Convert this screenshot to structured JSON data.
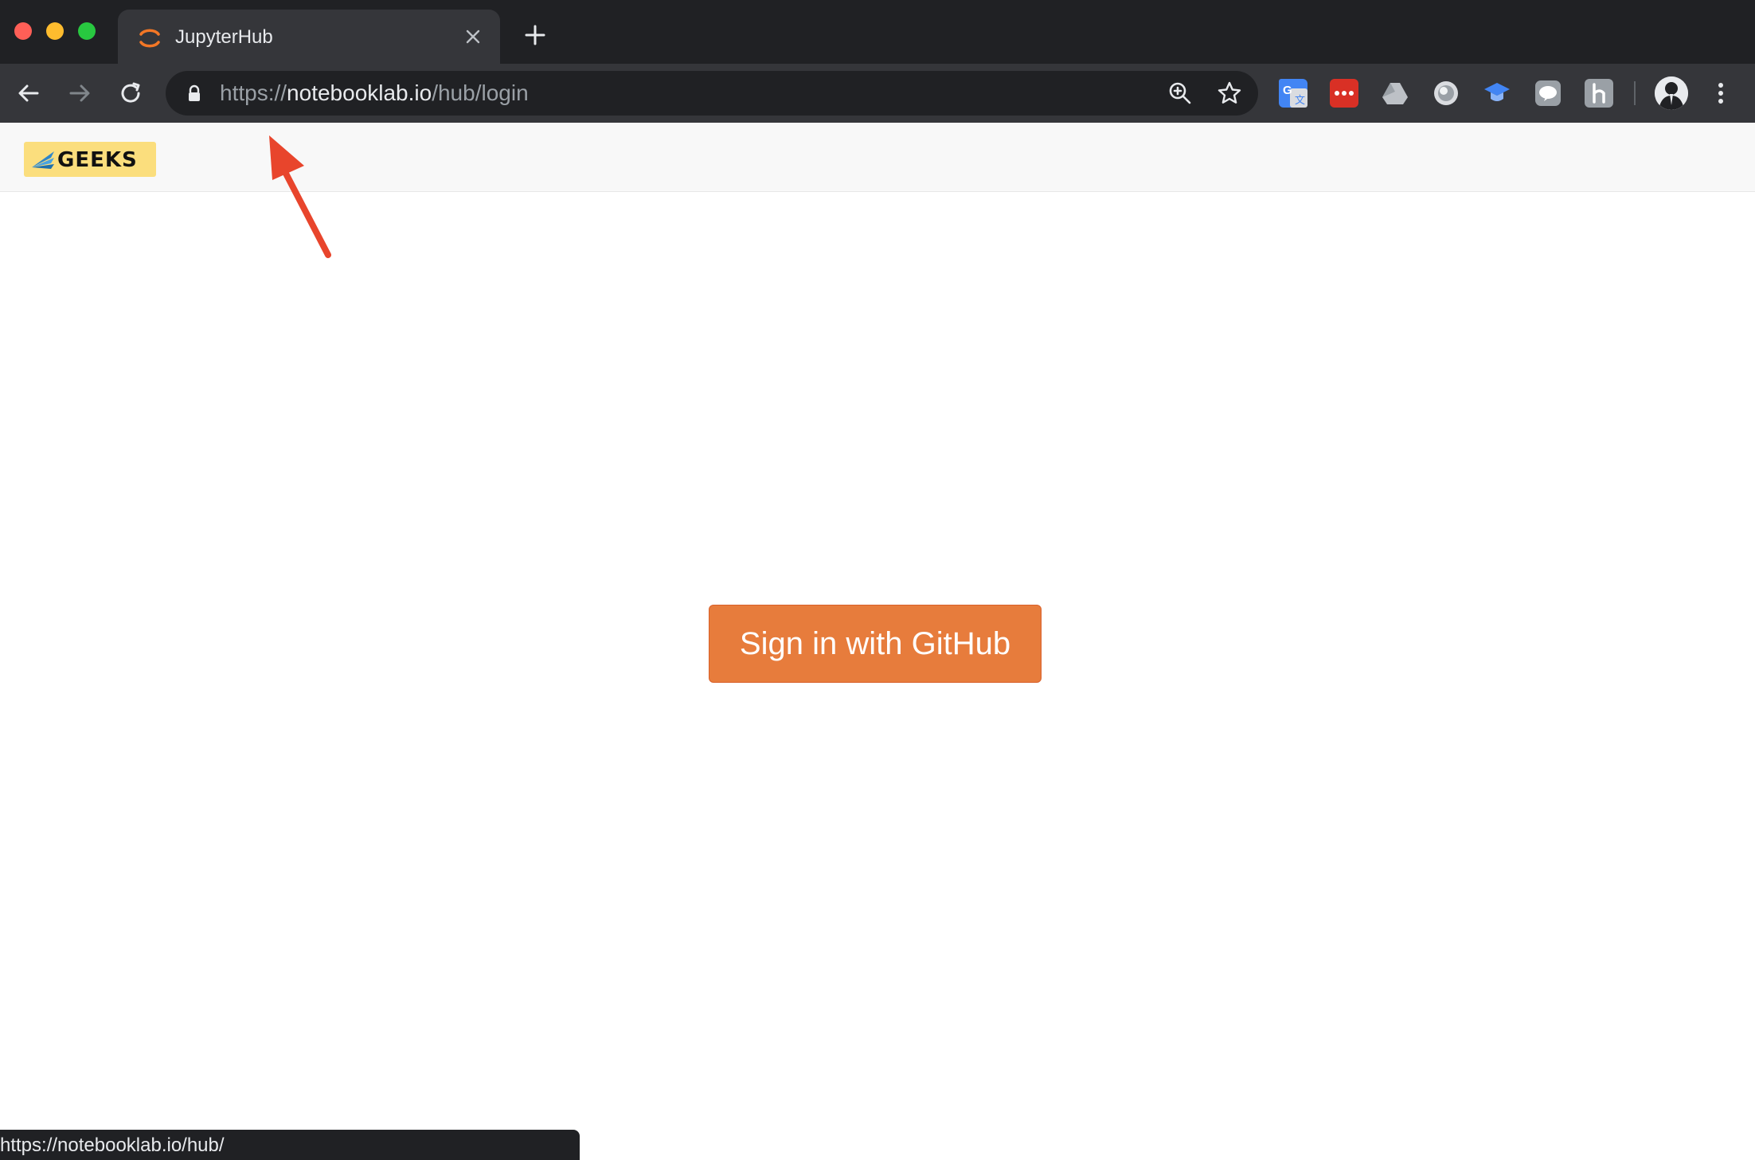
{
  "browser": {
    "tab": {
      "title": "JupyterHub",
      "favicon": "jupyter-icon"
    },
    "address_bar": {
      "scheme": "https://",
      "host": "notebooklab.io",
      "path": "/hub/login"
    },
    "extensions": [
      "google-translate-icon",
      "pocket-icon",
      "google-drive-icon",
      "circle-icon",
      "graduation-cap-icon",
      "line-chat-icon",
      "hatena-icon"
    ],
    "status_url": "https://notebooklab.io/hub/"
  },
  "page": {
    "logo_text": "GEEKS",
    "signin_label": "Sign in with GitHub"
  },
  "colors": {
    "accent": "#e77c3c",
    "annotation": "#e8452c",
    "logo_bg": "#fbde7d"
  }
}
